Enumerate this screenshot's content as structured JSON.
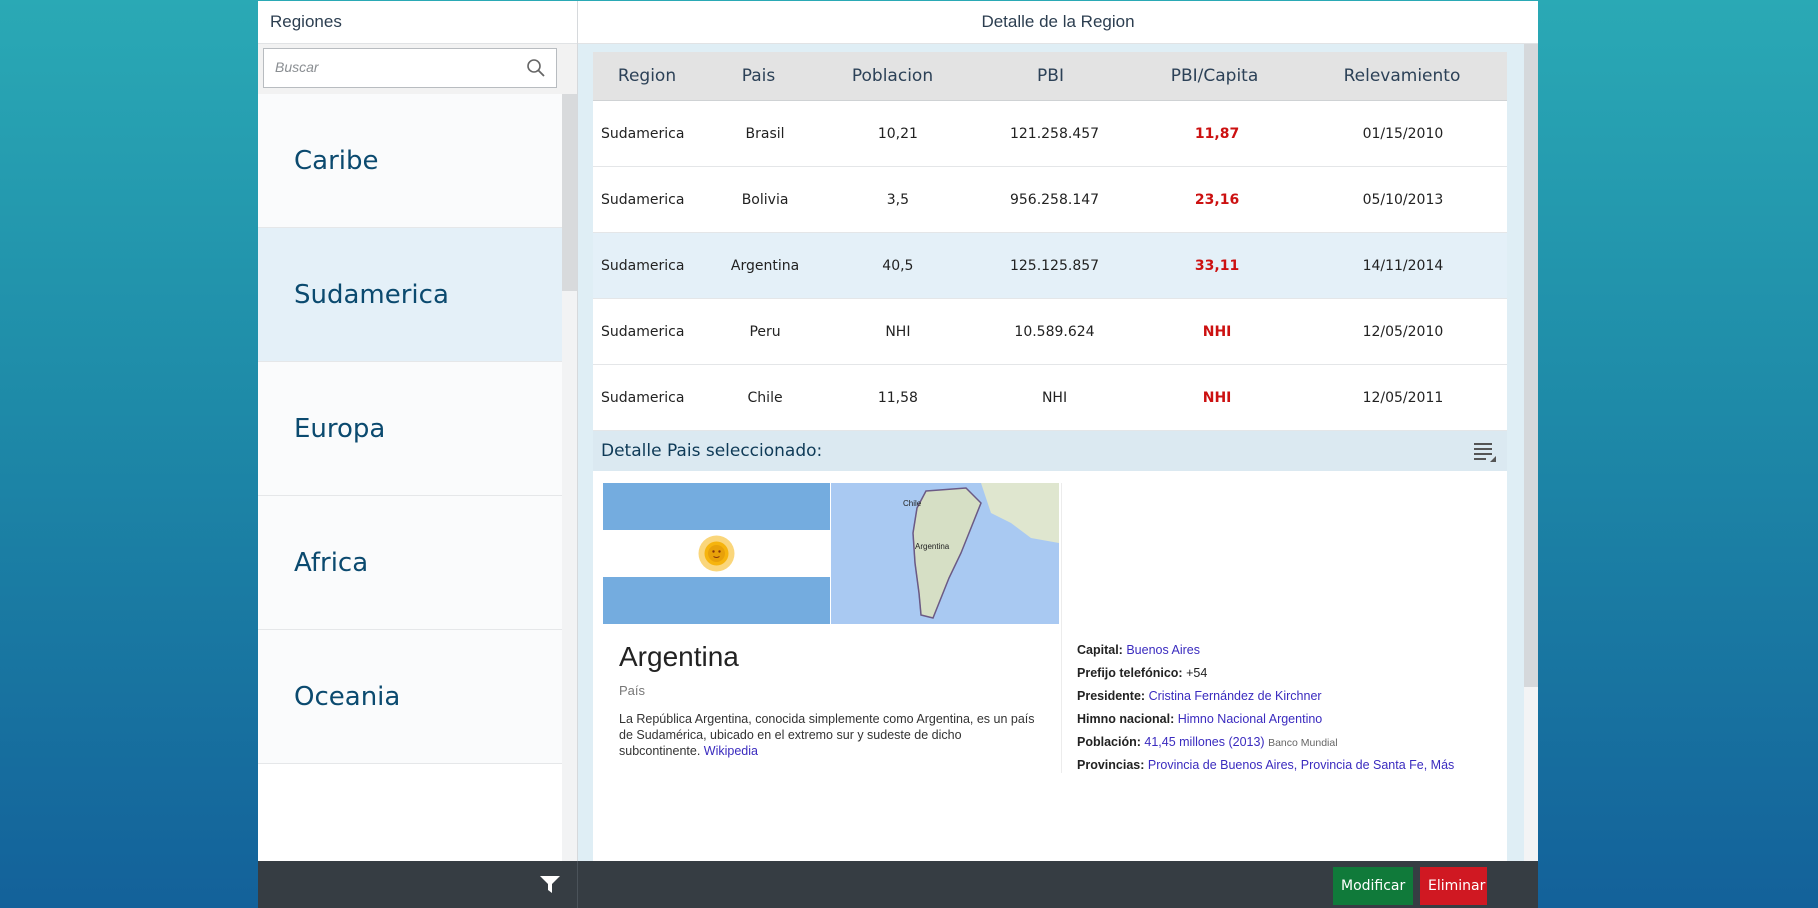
{
  "master": {
    "title": "Regiones",
    "search_placeholder": "Buscar",
    "regions": [
      "Caribe",
      "Sudamerica",
      "Europa",
      "Africa",
      "Oceania"
    ],
    "selected_region": "Sudamerica"
  },
  "detail": {
    "title": "Detalle de la Region",
    "columns": [
      "Region",
      "Pais",
      "Poblacion",
      "PBI",
      "PBI/Capita",
      "Relevamiento"
    ],
    "rows": [
      {
        "region": "Sudamerica",
        "pais": "Brasil",
        "poblacion": "10,21",
        "pbi": "121.258.457",
        "pbi_capita": "11,87",
        "relevamiento": "01/15/2010"
      },
      {
        "region": "Sudamerica",
        "pais": "Bolivia",
        "poblacion": "3,5",
        "pbi": "956.258.147",
        "pbi_capita": "23,16",
        "relevamiento": "05/10/2013"
      },
      {
        "region": "Sudamerica",
        "pais": "Argentina",
        "poblacion": "40,5",
        "pbi": "125.125.857",
        "pbi_capita": "33,11",
        "relevamiento": "14/11/2014"
      },
      {
        "region": "Sudamerica",
        "pais": "Peru",
        "poblacion": "NHI",
        "pbi": "10.589.624",
        "pbi_capita": "NHI",
        "relevamiento": "12/05/2010"
      },
      {
        "region": "Sudamerica",
        "pais": "Chile",
        "poblacion": "11,58",
        "pbi": "NHI",
        "pbi_capita": "NHI",
        "relevamiento": "12/05/2011"
      }
    ],
    "selected_row": 2,
    "sub_title": "Detalle Pais seleccionado:",
    "card": {
      "map_label_chile": "Chile",
      "map_label_argentina": "Argentina",
      "title": "Argentina",
      "subtitle": "País",
      "description": "La República Argentina, conocida simplemente como Argentina, es un país de Sudamérica, ubicado en el extremo sur y sudeste de dicho subcontinente.",
      "source_link": "Wikipedia",
      "facts": {
        "capital_label": "Capital:",
        "capital_value": "Buenos Aires",
        "prefijo_label": "Prefijo telefónico:",
        "prefijo_value": "+54",
        "presidente_label": "Presidente:",
        "presidente_value": "Cristina Fernández de Kirchner",
        "himno_label": "Himno nacional:",
        "himno_value": "Himno Nacional Argentino",
        "poblacion_label": "Población:",
        "poblacion_value": "41,45 millones (2013)",
        "poblacion_source": "Banco Mundial",
        "provincias_label": "Provincias:",
        "provincias_value": "Provincia de Buenos Aires, Provincia de Santa Fe, Más"
      }
    }
  },
  "footer": {
    "modificar_label": "Modificar",
    "eliminar_label": "Eliminar"
  },
  "colors": {
    "accent_text": "#0b4a6f",
    "selected_bg": "#e4f0f8",
    "red_value": "#cc1111",
    "footer_bg": "#363d43",
    "modificar_bg": "#107a3a",
    "eliminar_bg": "#d01822"
  },
  "icons": [
    "search-icon",
    "filter-icon",
    "list-menu-icon"
  ]
}
